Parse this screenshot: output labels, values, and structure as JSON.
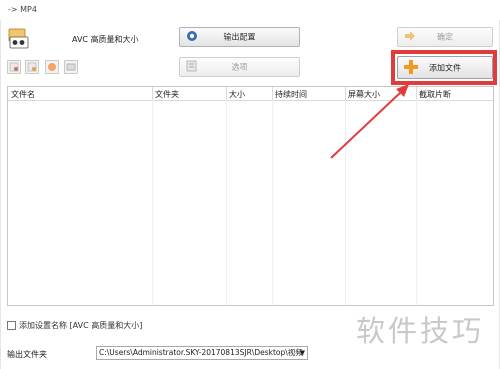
{
  "window": {
    "title": "-> MP4"
  },
  "profile": {
    "name": "AVC 高质量和大小"
  },
  "buttons": {
    "output_config": "输出配置",
    "confirm": "确定",
    "options": "选项",
    "add_file": "添加文件"
  },
  "table": {
    "columns": [
      "文件名",
      "文件夹",
      "大小",
      "持续时间",
      "屏幕大小",
      "截取片断"
    ],
    "rows": []
  },
  "add_setting_name": {
    "label": "添加设置名称 [AVC 高质量和大小]",
    "checked": false
  },
  "output_folder": {
    "label": "输出文件夹",
    "value": "C:\\Users\\Administrator.SKY-20170813SJR\\Desktop\\视频"
  },
  "watermark": "软件技巧",
  "colors": {
    "highlight": "#e03c3c",
    "add_icon": "#f39a1e"
  }
}
